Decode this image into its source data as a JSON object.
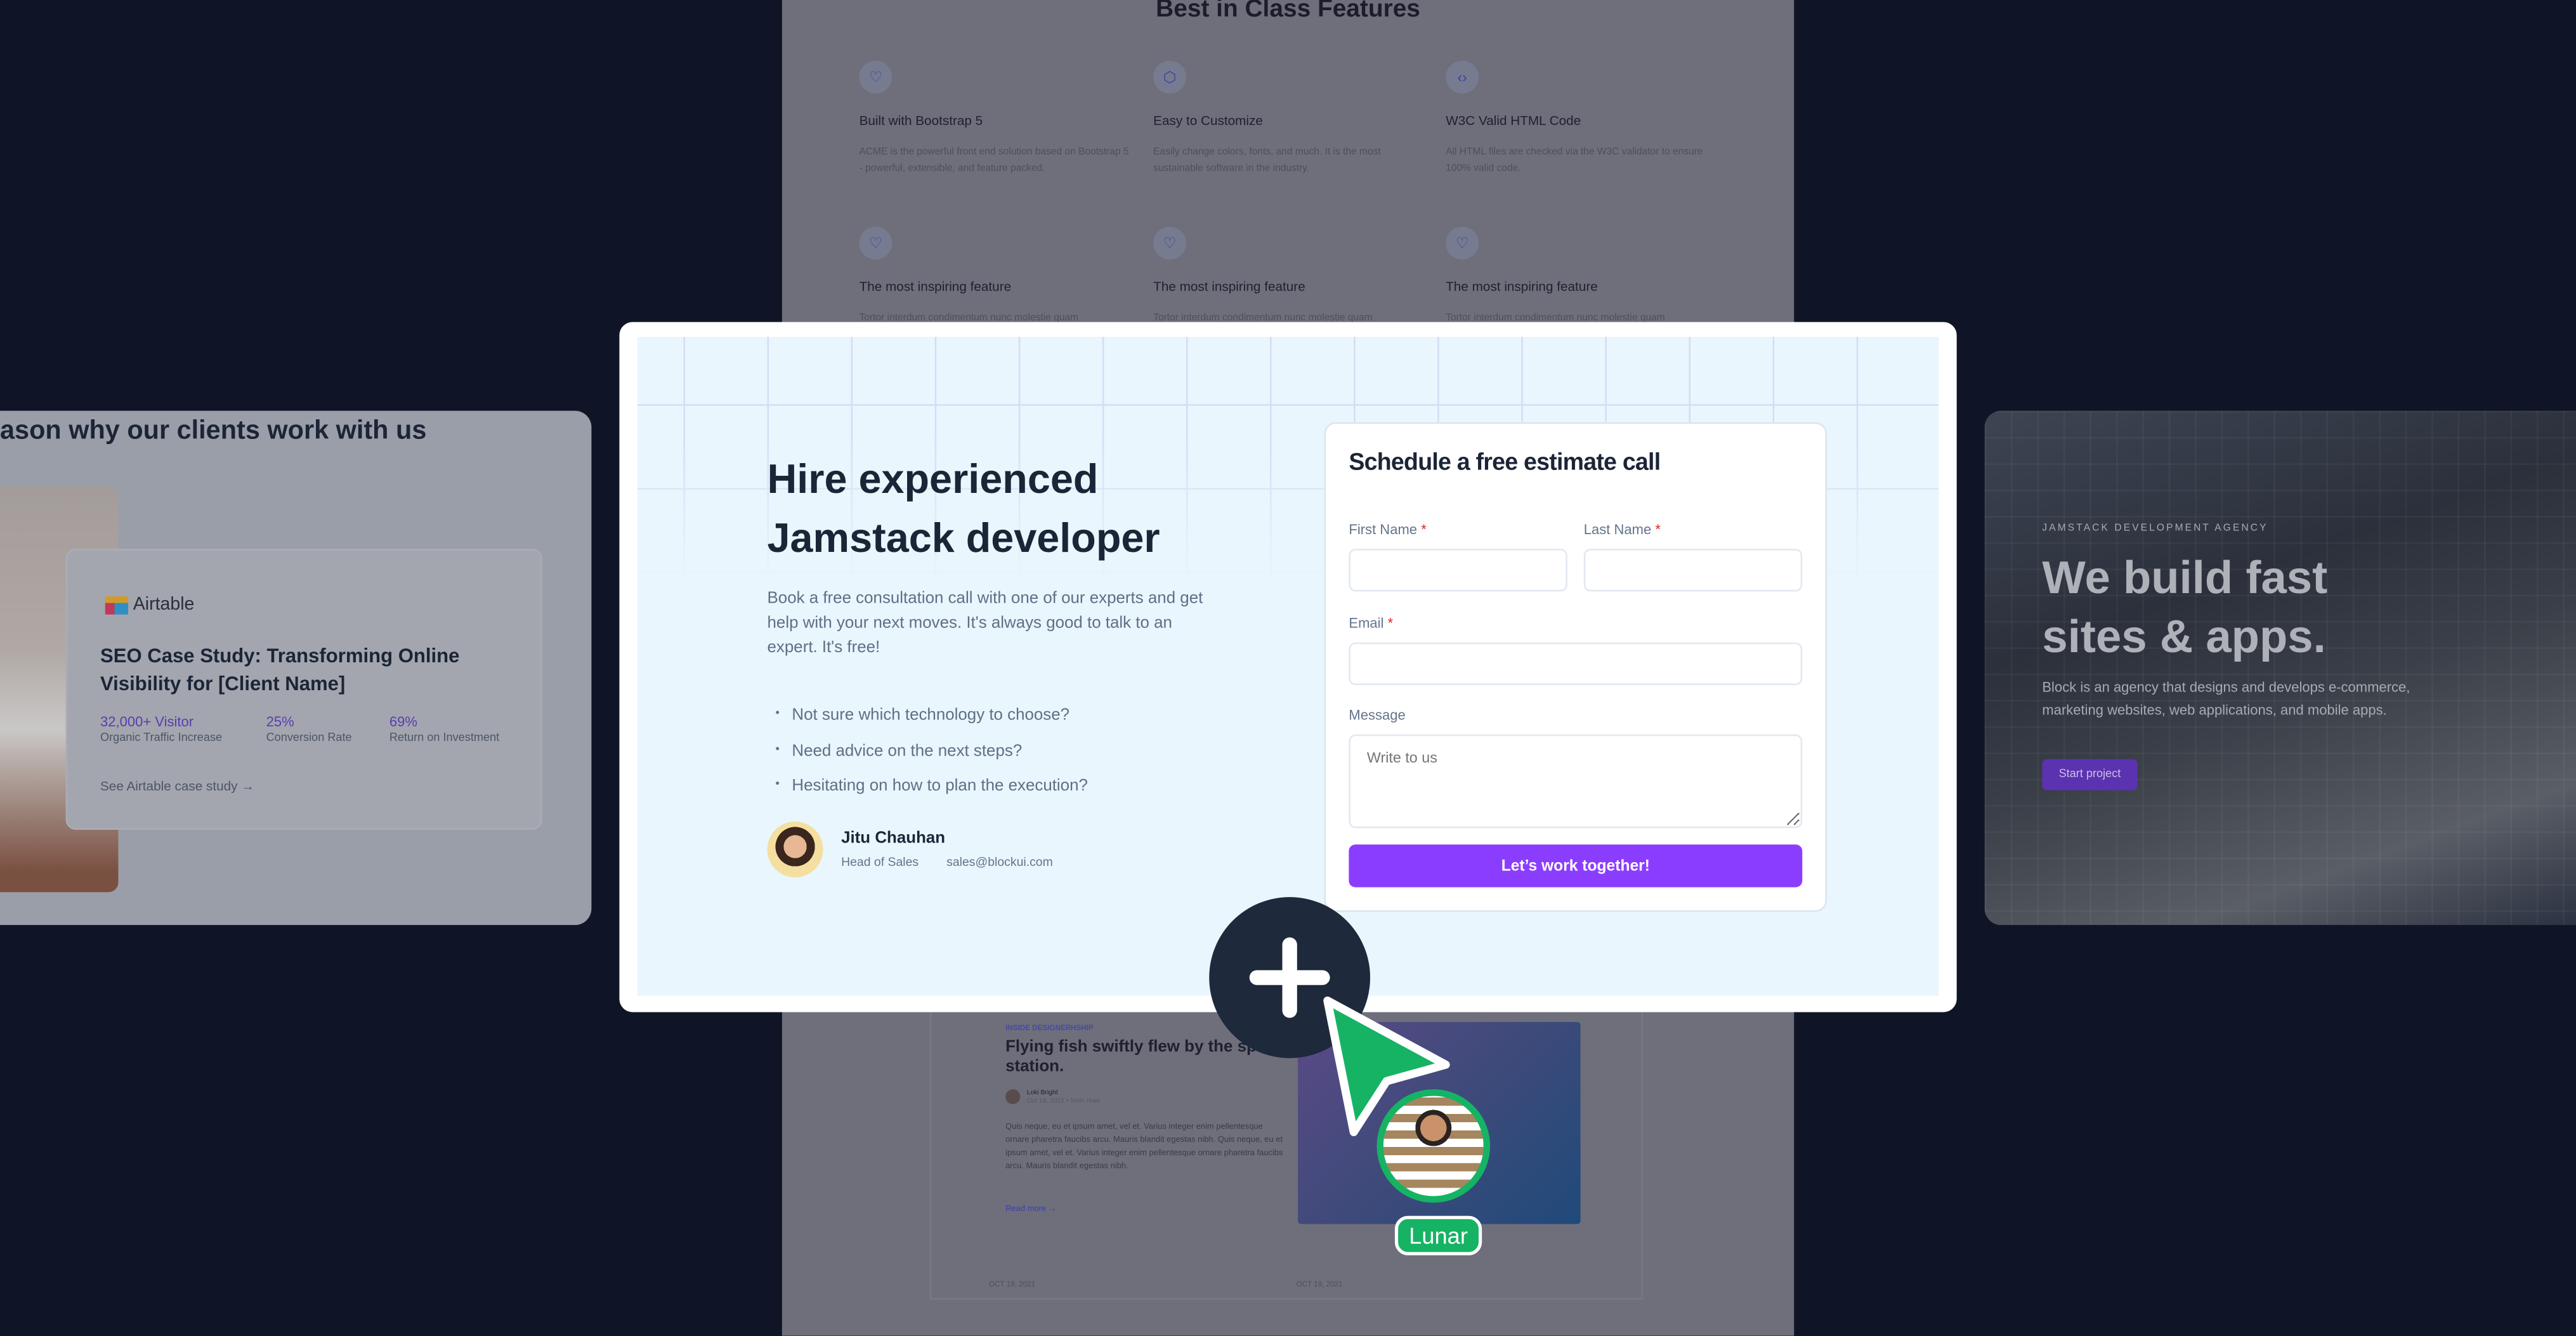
{
  "background_page": {
    "heading": "Best in Class Features",
    "features": [
      {
        "icon": "heart-icon",
        "title": "Built with Bootstrap 5",
        "desc": "ACME is the powerful front end solution based on Bootstrap 5 - powerful, extensible, and feature packed."
      },
      {
        "icon": "cube-icon",
        "title": "Easy to Customize",
        "desc": "Easily change colors, fonts, and much. It is the most sustainable software in the industry."
      },
      {
        "icon": "code-icon",
        "title": "W3C Valid HTML Code",
        "desc": "All HTML files are checked via the W3C validator to ensure 100% valid code."
      },
      {
        "icon": "heart-icon",
        "title": "The most inspiring feature",
        "desc": "Tortor interdum condimentum nunc molestie quam"
      },
      {
        "icon": "heart-icon",
        "title": "The most inspiring feature",
        "desc": "Tortor interdum condimentum nunc molestie quam"
      },
      {
        "icon": "heart-icon",
        "title": "The most inspiring feature",
        "desc": "Tortor interdum condimentum nunc molestie quam"
      }
    ],
    "blog": {
      "category": "INSIDE DESIGNERHSHIP",
      "title": "Flying fish swiftly flew by the space station.",
      "author": "Loki Bright",
      "meta": "Oct 19, 2021 • 5min read",
      "body": "Quis neque, eu et ipsum amet, vel et. Varius integer enim pellentesque ornare pharetra faucibs arcu. Mauris blandit egestas nibh. Quis neque, eu et ipsum amet, vel et. Varius integer enim pellentesque ornare pharetra faucibs arcu. Mauris blandit egestas nibh.",
      "read_more": "Read more →",
      "dates": [
        "OCT 19, 2021",
        "OCT 19, 2021"
      ]
    }
  },
  "left_card": {
    "heading": "ason why our clients work with us",
    "case": {
      "logo": "Airtable",
      "title": "SEO Case Study: Transforming Online Visibility for [Client Name]",
      "stats": [
        {
          "value": "32,000+ Visitor",
          "label": "Organic Traffic Increase"
        },
        {
          "value": "25%",
          "label": "Conversion Rate"
        },
        {
          "value": "69%",
          "label": "Return on Investment"
        }
      ],
      "link": "See Airtable case study →"
    }
  },
  "right_card": {
    "eyebrow": "JAMSTACK DEVELOPMENT AGENCY",
    "headline": "We build fast sites & apps.",
    "desc": "Block is an agency that designs and develops e-commerce, marketing websites, web applications, and mobile apps.",
    "button": "Start project"
  },
  "main_card": {
    "title": "Hire experienced Jamstack developer",
    "desc": "Book a free consultation call with one of our experts and get help with your next moves. It's always good to talk to an expert. It's free!",
    "bullets": [
      "Not sure which technology to choose?",
      "Need advice on the next steps?",
      "Hesitating on how to plan the execution?"
    ],
    "contact": {
      "name": "Jitu Chauhan",
      "role": "Head of Sales",
      "email": "sales@blockui.com"
    },
    "form": {
      "title": "Schedule a free estimate call",
      "first_name_label": "First Name",
      "last_name_label": "Last Name",
      "email_label": "Email",
      "message_label": "Message",
      "required_mark": "*",
      "first_name_value": "",
      "last_name_value": "",
      "email_value": "",
      "message_placeholder": "Write to us",
      "submit": "Let’s work together!"
    }
  },
  "overlay": {
    "add_icon": "plus-icon",
    "cursor_icon": "cursor-arrow-icon",
    "user_label": "Lunar",
    "colors": {
      "accent": "#8b3dff",
      "cursor": "#16b364",
      "plus_bg": "#1e293b",
      "background": "#0f1427"
    }
  }
}
